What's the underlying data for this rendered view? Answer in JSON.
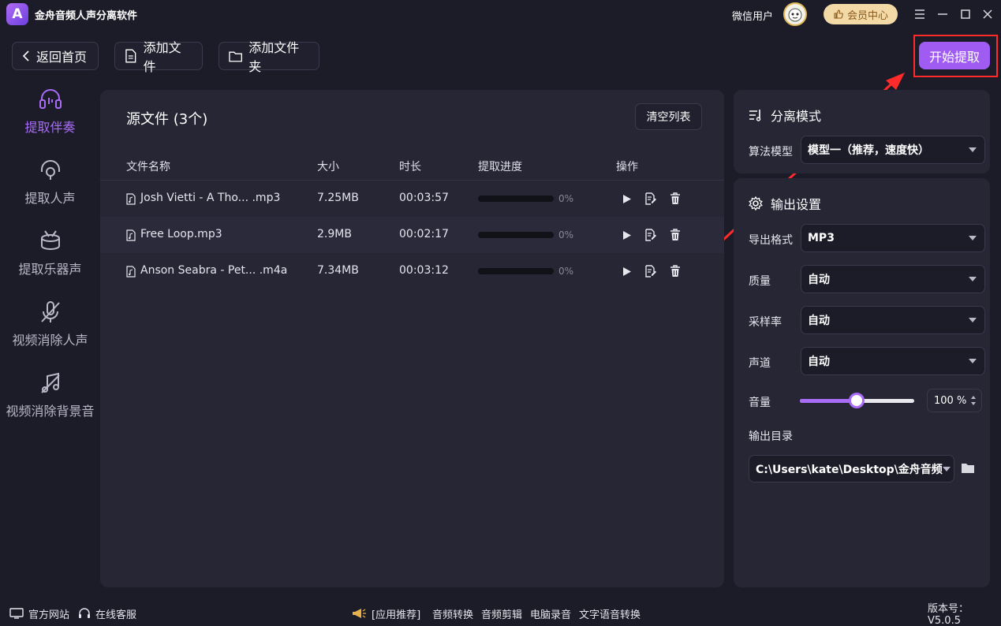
{
  "app": {
    "logo_letter": "A",
    "title": "金舟音频人声分离软件",
    "username": "微信用户",
    "vip_label": "会员中心"
  },
  "toolbar": {
    "back": "返回首页",
    "add_file": "添加文件",
    "add_folder": "添加文件夹",
    "start": "开始提取"
  },
  "nav": [
    {
      "label": "提取伴奏",
      "icon": "headphones-icon",
      "active": true
    },
    {
      "label": "提取人声",
      "icon": "vocal-icon"
    },
    {
      "label": "提取乐器声",
      "icon": "drum-icon"
    },
    {
      "label": "视频消除人声",
      "icon": "mic-off-icon"
    },
    {
      "label": "视频消除背景音",
      "icon": "music-off-icon"
    }
  ],
  "files": {
    "title": "源文件 (3个)",
    "clear": "清空列表",
    "headers": {
      "name": "文件名称",
      "size": "大小",
      "duration": "时长",
      "progress": "提取进度",
      "ops": "操作"
    },
    "rows": [
      {
        "name": "Josh Vietti - A Tho... .mp3",
        "size": "7.25MB",
        "duration": "00:03:57",
        "progress": 0,
        "progress_label": "0%"
      },
      {
        "name": "Free Loop.mp3",
        "size": "2.9MB",
        "duration": "00:02:17",
        "progress": 0,
        "progress_label": "0%"
      },
      {
        "name": "Anson Seabra - Pet... .m4a",
        "size": "7.34MB",
        "duration": "00:03:12",
        "progress": 0,
        "progress_label": "0%"
      }
    ]
  },
  "mode": {
    "title": "分离模式",
    "algo_label": "算法模型",
    "algo_value": "模型一（推荐，速度快）"
  },
  "output": {
    "title": "输出设置",
    "format_label": "导出格式",
    "format_value": "MP3",
    "quality_label": "质量",
    "quality_value": "自动",
    "rate_label": "采样率",
    "rate_value": "自动",
    "channel_label": "声道",
    "channel_value": "自动",
    "volume_label": "音量",
    "volume_value": "100 %",
    "volume_fraction": 0.5,
    "dir_label": "输出目录",
    "dir_value": "C:\\Users\\kate\\Desktop\\金舟音频"
  },
  "footer": {
    "website": "官方网站",
    "support": "在线客服",
    "recommend": "[应用推荐]",
    "links": [
      "音频转换",
      "音频剪辑",
      "电脑录音",
      "文字语音转换"
    ],
    "version": "版本号：V5.0.5"
  },
  "colors": {
    "accent": "#a86cf6",
    "bg": "#1c1c28",
    "panel": "#262635",
    "highlight": "#ff2a2a"
  }
}
